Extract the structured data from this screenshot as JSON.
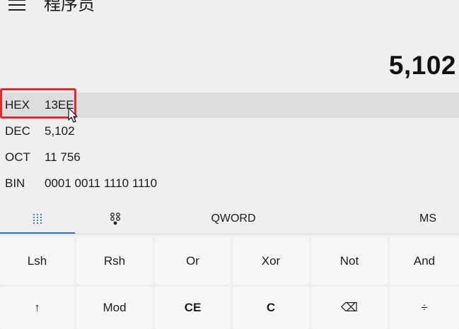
{
  "app": {
    "title": "程序员"
  },
  "display": {
    "value": "5,102"
  },
  "radix": [
    {
      "label": "HEX",
      "value": "13EE"
    },
    {
      "label": "DEC",
      "value": "5,102"
    },
    {
      "label": "OCT",
      "value": "11 756"
    },
    {
      "label": "BIN",
      "value": "0001 0011 1110 1110"
    }
  ],
  "toolbar": {
    "keypad_icon": "dot-grid-icon",
    "bitflip_icon": "bit-toggle-icon",
    "word_size": "QWORD",
    "memory": "MS"
  },
  "keys": {
    "row1": [
      "Lsh",
      "Rsh",
      "Or",
      "Xor",
      "Not",
      "And"
    ],
    "row2": [
      "↑",
      "Mod",
      "CE",
      "C",
      "⌫",
      "÷"
    ]
  },
  "colors": {
    "accent": "#3b6fbf",
    "highlight": "#e8262e"
  }
}
